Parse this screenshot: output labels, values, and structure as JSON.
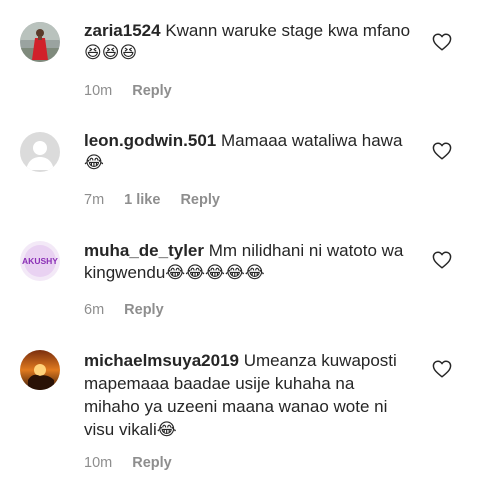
{
  "comments": [
    {
      "username": "zaria1524",
      "text": "Kwann waruke stage kwa mfano",
      "emojis": [
        "😆",
        "😆",
        "😆"
      ],
      "time": "10m",
      "likes": "",
      "reply_label": "Reply",
      "avatar_icon": "woman-red-dress-avatar"
    },
    {
      "username": "leon.godwin.501",
      "text": "Mamaaa wataliwa hawa",
      "emojis": [
        "😂"
      ],
      "time": "7m",
      "likes": "1 like",
      "reply_label": "Reply",
      "avatar_icon": "default-user-avatar"
    },
    {
      "username": "muha_de_tyler",
      "text": "Mm nilidhani ni watoto wa kingwendu",
      "emojis": [
        "😂",
        "😂",
        "😂",
        "😂",
        "😂"
      ],
      "time": "6m",
      "likes": "",
      "reply_label": "Reply",
      "avatar_icon": "akushy-logo-avatar",
      "avatar_text": "AKUSHY"
    },
    {
      "username": "michaelmsuya2019",
      "text": "Umeanza kuwaposti mapemaaa baadae usije kuhaha na mihaho ya uzeeni maana wanao wote ni visu vikali",
      "emojis": [
        "😂"
      ],
      "time": "10m",
      "likes": "",
      "reply_label": "Reply",
      "avatar_icon": "sunset-lion-avatar"
    }
  ],
  "colors": {
    "text": "#262626",
    "meta": "#8e8e8e",
    "heart_stroke": "#262626"
  },
  "icons": {
    "like": "heart-outline-icon"
  }
}
